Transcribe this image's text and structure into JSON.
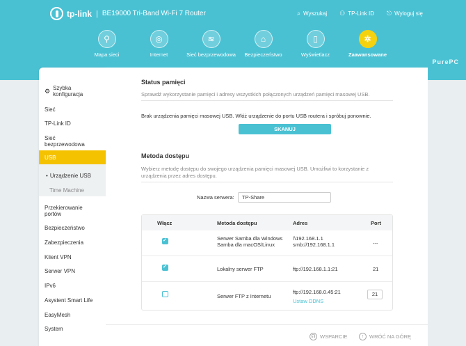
{
  "header": {
    "brand": "tp-link",
    "model": "BE19000 Tri-Band Wi-Fi 7 Router",
    "links": [
      {
        "icon": "search-icon",
        "label": "Wyszukaj"
      },
      {
        "icon": "user-icon",
        "label": "TP-Link ID"
      },
      {
        "icon": "logout-icon",
        "label": "Wyloguj się"
      }
    ]
  },
  "nav": {
    "items": [
      {
        "icon": "network-map-icon",
        "label": "Mapa sieci"
      },
      {
        "icon": "globe-icon",
        "label": "Internet"
      },
      {
        "icon": "wifi-icon",
        "label": "Sieć bezprzewodowa"
      },
      {
        "icon": "shield-icon",
        "label": "Bezpieczeństwo"
      },
      {
        "icon": "display-icon",
        "label": "Wyświetlacz"
      },
      {
        "icon": "gear-icon",
        "label": "Zaawansowane"
      }
    ],
    "active": "Zaawansowane"
  },
  "watermark": "PurePC",
  "sidebar": {
    "items": [
      {
        "label": "Szybka konfiguracja"
      },
      {
        "label": "Sieć"
      },
      {
        "label": "TP-Link ID"
      },
      {
        "label": "Sieć bezprzewodowa"
      },
      {
        "label": "USB"
      },
      {
        "label": "Urządzenie USB"
      },
      {
        "label": "Time Machine"
      },
      {
        "label": "Przekierowanie portów"
      },
      {
        "label": "Bezpieczeństwo"
      },
      {
        "label": "Zabezpieczenia"
      },
      {
        "label": "Klient VPN"
      },
      {
        "label": "Serwer VPN"
      },
      {
        "label": "IPv6"
      },
      {
        "label": "Asystent Smart Life"
      },
      {
        "label": "EasyMesh"
      },
      {
        "label": "System"
      }
    ]
  },
  "memory_status": {
    "title": "Status pamięci",
    "description": "Sprawdź wykorzystanie pamięci i adresy wszystkich połączonych urządzeń pamięci masowej USB.",
    "message": "Brak urządzenia pamięci masowej USB. Włóż urządzenie do portu USB routera i spróbuj ponownie.",
    "scan_button": "SKANUJ"
  },
  "access_method": {
    "title": "Metoda dostępu",
    "description_line1": "Wybierz metodę dostępu do swojego urządzenia pamięci masowej USB. Umożliwi to korzystanie z",
    "description_line2": "urządzenia przez adres dostępu.",
    "server_name_label": "Nazwa serwera:",
    "server_name_value": "TP-Share",
    "table": {
      "headers": [
        "Włącz",
        "Metoda dostępu",
        "Adres",
        "Port"
      ],
      "rows": [
        {
          "enabled": true,
          "method_line1": "Serwer Samba dla Windows",
          "method_line2": "Samba dla macOS/Linux",
          "address_line1": "\\\\192.168.1.1",
          "address_line2": "smb://192.168.1.1",
          "port": "---"
        },
        {
          "enabled": true,
          "method_line1": "Lokalny serwer FTP",
          "address_line1": "ftp://192.168.1.1:21",
          "port": "21"
        },
        {
          "enabled": false,
          "method_line1": "Serwer FTP z Internetu",
          "address_line1": "ftp://192.168.0.45:21",
          "address_link": "Ustaw DDNS",
          "port": "21"
        }
      ]
    }
  },
  "footer": {
    "support": "WSPARCIE",
    "back_to_top": "WRÓĆ NA GÓRĘ"
  }
}
